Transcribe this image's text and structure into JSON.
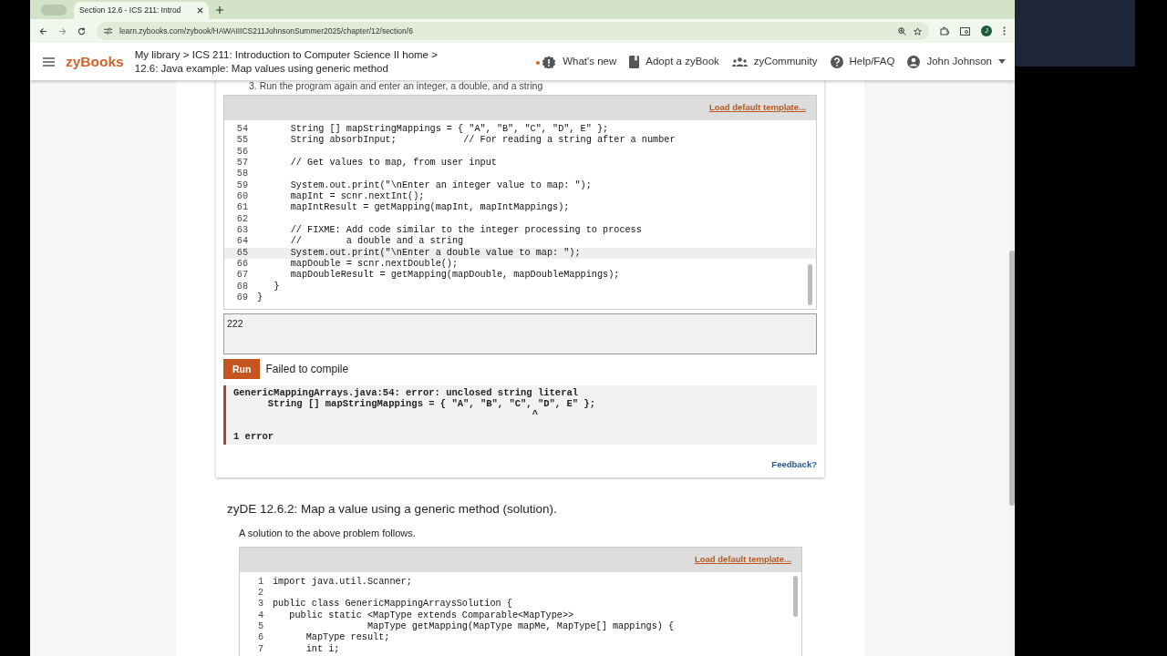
{
  "browser": {
    "tab_title": "Section 12.6 - ICS 211: Introd",
    "url": "learn.zybooks.com/zybook/HAWAIIICS211JohnsonSummer2025/chapter/12/section/6",
    "profile_initial": "J"
  },
  "header": {
    "logo": "zyBooks",
    "breadcrumb": [
      "My library > ICS 211: Introduction to Computer Science II home >",
      "12.6: Java example: Map values using generic method"
    ],
    "nav": [
      {
        "kind": "news",
        "label": "What's new"
      },
      {
        "kind": "book",
        "label": "Adopt a zyBook"
      },
      {
        "kind": "community",
        "label": "zyCommunity"
      },
      {
        "kind": "help",
        "label": "Help/FAQ"
      },
      {
        "kind": "user",
        "label": "John Johnson"
      }
    ]
  },
  "instruction": "3. Run the program again and enter an integer, a double, and a string",
  "editor": {
    "load_template": "Load default template...",
    "lines": [
      {
        "number": "54",
        "code": "      String [] mapStringMappings = { \"A\", \"B\", \"C\", \"D\", E\" };",
        "current": false
      },
      {
        "number": "55",
        "code": "      String absorbInput;            // For reading a string after a number",
        "current": false
      },
      {
        "number": "56",
        "current": false
      },
      {
        "number": "57",
        "code": "      // Get values to map, from user input",
        "current": false
      },
      {
        "number": "58",
        "current": false
      },
      {
        "number": "59",
        "code": "      System.out.print(\"\\nEnter an integer value to map: \");",
        "current": false
      },
      {
        "number": "60",
        "code": "      mapInt = scnr.nextInt();",
        "current": false
      },
      {
        "number": "61",
        "code": "      mapIntResult = getMapping(mapInt, mapIntMappings);",
        "current": false
      },
      {
        "number": "62",
        "current": false
      },
      {
        "number": "63",
        "code": "      // FIXME: Add code similar to the integer processing to process",
        "current": false
      },
      {
        "number": "64",
        "code": "      //        a double and a string",
        "current": false
      },
      {
        "number": "65",
        "code": "      System.out.print(\"\\nEnter a double value to map: \");",
        "current": true
      },
      {
        "number": "66",
        "code": "      mapDouble = scnr.nextDouble();",
        "current": false
      },
      {
        "number": "67",
        "code": "      mapDoubleResult = getMapping(mapDouble, mapDoubleMappings);",
        "current": false
      },
      {
        "number": "68",
        "code": "   }",
        "current": false
      },
      {
        "number": "69",
        "code": "}",
        "current": false
      }
    ],
    "input": "222",
    "run": "Run",
    "status": "Failed to compile",
    "error": "GenericMappingArrays.java:54: error: unclosed string literal\n      String [] mapStringMappings = { \"A\", \"B\", \"C\", \"D\", E\" };\n                                                    ^\n\n1 error",
    "feedback": "Feedback?"
  },
  "solution": {
    "title": "zyDE 12.6.2: Map a value using a generic method (solution).",
    "description": "A solution to the above problem follows.",
    "load_template": "Load default template...",
    "lines": [
      {
        "number": "1",
        "code": "import java.util.Scanner;",
        "current": false
      },
      {
        "number": "2",
        "current": false
      },
      {
        "number": "3",
        "code": "public class GenericMappingArraysSolution {",
        "current": false
      },
      {
        "number": "4",
        "code": "   public static <MapType extends Comparable<MapType>>",
        "current": false
      },
      {
        "number": "5",
        "code": "                 MapType getMapping(MapType mapMe, MapType[] mappings) {",
        "current": false
      },
      {
        "number": "6",
        "code": "      MapType result;",
        "current": false
      },
      {
        "number": "7",
        "code": "      int i;",
        "current": false
      }
    ]
  }
}
